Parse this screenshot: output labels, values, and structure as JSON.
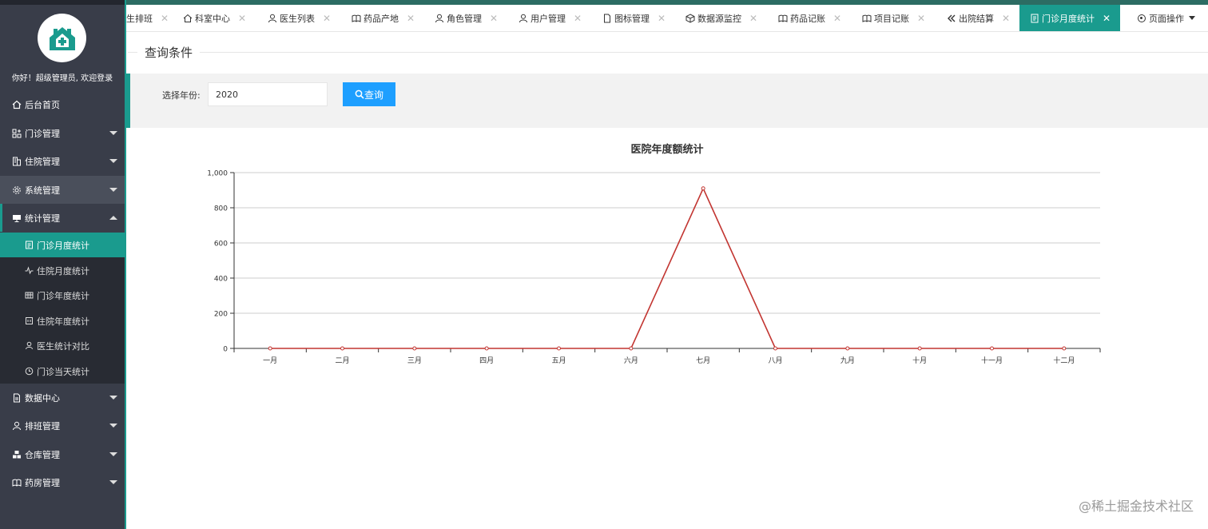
{
  "sidebar": {
    "greeting": "你好！超级管理员, 欢迎登录",
    "menu": [
      {
        "label": "后台首页"
      },
      {
        "label": "门诊管理"
      },
      {
        "label": "住院管理"
      },
      {
        "label": "系统管理"
      },
      {
        "label": "统计管理"
      },
      {
        "label": "数据中心"
      },
      {
        "label": "排班管理"
      },
      {
        "label": "仓库管理"
      },
      {
        "label": "药房管理"
      }
    ],
    "submenu": [
      {
        "label": "门诊月度统计"
      },
      {
        "label": "住院月度统计"
      },
      {
        "label": "门诊年度统计"
      },
      {
        "label": "住院年度统计"
      },
      {
        "label": "医生统计对比"
      },
      {
        "label": "门诊当天统计"
      }
    ]
  },
  "tabs": [
    {
      "label": "生排班"
    },
    {
      "label": "科室中心"
    },
    {
      "label": "医生列表"
    },
    {
      "label": "药品产地"
    },
    {
      "label": "角色管理"
    },
    {
      "label": "用户管理"
    },
    {
      "label": "图标管理"
    },
    {
      "label": "数据源监控"
    },
    {
      "label": "药品记账"
    },
    {
      "label": "项目记账"
    },
    {
      "label": "出院结算"
    },
    {
      "label": "门诊月度统计"
    }
  ],
  "tab_close": "✕",
  "page_ops_label": "页面操作",
  "query": {
    "legend": "查询条件",
    "year_label": "选择年份:",
    "year_value": "2020",
    "button_label": "查询"
  },
  "chart_data": {
    "type": "line",
    "title": "医院年度额统计",
    "categories": [
      "一月",
      "二月",
      "三月",
      "四月",
      "五月",
      "六月",
      "七月",
      "八月",
      "九月",
      "十月",
      "十一月",
      "十二月"
    ],
    "series": [
      {
        "values": [
          0,
          0,
          0,
          0,
          0,
          0,
          910,
          0,
          0,
          0,
          0,
          0
        ],
        "color": "#c23531"
      }
    ],
    "yticks": [
      "0",
      "200",
      "400",
      "600",
      "800",
      "1,000"
    ],
    "ylim": [
      0,
      1000
    ],
    "grid": true
  },
  "watermark": "@稀土掘金技术社区",
  "colors": {
    "sidebar_bg": "#393d49",
    "accent": "#1a9b8e",
    "button_blue": "#1e9fff"
  }
}
